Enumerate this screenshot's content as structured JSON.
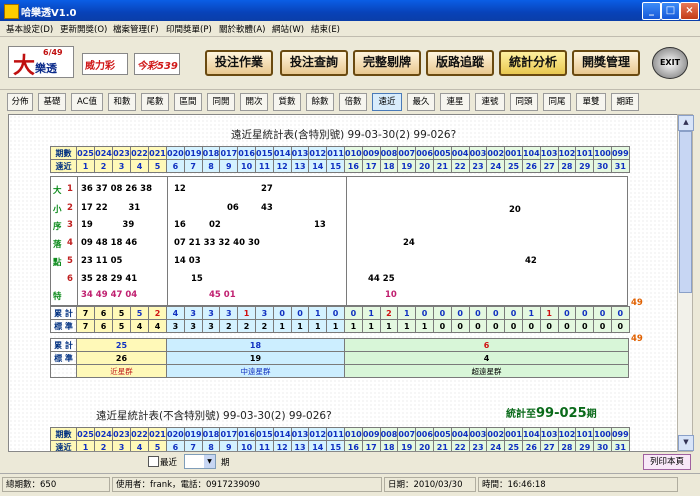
{
  "window": {
    "title": "哈樂透V1.0"
  },
  "menu": [
    "基本設定(D)",
    "更新開獎(O)",
    "檔案管理(F)",
    "印間獎單(P)",
    "關於軟體(A)",
    "網站(W)",
    "結束(E)"
  ],
  "logos": {
    "main_small": "6/49",
    "main_big": "大樂透",
    "logo2": "威力彩",
    "logo3": "今彩539"
  },
  "toolbar_buttons": [
    "投注作業",
    "投注查詢",
    "完整剔牌",
    "版路追蹤",
    "統計分析",
    "開獎管理"
  ],
  "exit_label": "EXIT",
  "tabs": [
    "分佈",
    "基礎",
    "AC值",
    "和數",
    "尾數",
    "區間",
    "同開",
    "開次",
    "質數",
    "餘數",
    "倍數",
    "遠近",
    "最久",
    "連星",
    "連號",
    "同頭",
    "同尾",
    "單雙",
    "期距"
  ],
  "active_tab": "遠近",
  "table1": {
    "title": "遠近星統計表(含特別號)  99-03-30(2)  99-026?",
    "period_label": "期數",
    "distance_label": "遠近",
    "periods_near": [
      "025",
      "024",
      "023",
      "022",
      "021"
    ],
    "periods_mid": [
      "020",
      "019",
      "018",
      "017",
      "016",
      "015",
      "014",
      "013",
      "012",
      "011"
    ],
    "periods_far": [
      "010",
      "009",
      "008",
      "007",
      "006",
      "005",
      "004",
      "003",
      "002",
      "001",
      "104",
      "103",
      "102",
      "101",
      "100",
      "099"
    ],
    "dist_near": [
      "1",
      "2",
      "3",
      "4",
      "5"
    ],
    "dist_mid": [
      "6",
      "7",
      "8",
      "9",
      "10",
      "11",
      "12",
      "13",
      "14",
      "15"
    ],
    "dist_far": [
      "16",
      "17",
      "18",
      "19",
      "20",
      "21",
      "22",
      "23",
      "24",
      "25",
      "26",
      "27",
      "28",
      "29",
      "30",
      "31"
    ],
    "side_labels": [
      "大",
      "小",
      "序",
      "落",
      "點",
      "",
      "特"
    ],
    "side_nums": [
      "1",
      "2",
      "3",
      "4",
      "5",
      "6",
      ""
    ],
    "near_rows": [
      "36 37 08 26 38",
      "17 22       31",
      "19          39",
      "09 48 18 46",
      "23 11 05",
      "35 28 29 41",
      "34 49 47 04"
    ],
    "mid_rows": [
      [
        "12",
        "27"
      ],
      [
        "06",
        "43"
      ],
      [
        "16",
        "02",
        "13"
      ],
      [
        "07 21 33 32 40 30"
      ],
      [
        "14 03"
      ],
      [
        "15"
      ],
      [
        "45 01"
      ]
    ],
    "far_rows": [
      [
        "20"
      ],
      [
        "24"
      ],
      [
        "42"
      ],
      [
        "44 25"
      ],
      [
        "10"
      ]
    ],
    "cum_label": "累 計",
    "std_label": "標 準",
    "cum_values": [
      "7",
      "6",
      "5",
      "5",
      "2",
      "4",
      "3",
      "3",
      "3",
      "1",
      "3",
      "0",
      "0",
      "1",
      "0",
      "0",
      "1",
      "2",
      "1",
      "0",
      "0",
      "0",
      "0",
      "0",
      "0",
      "1",
      "1",
      "0",
      "0",
      "0",
      "0",
      "0"
    ],
    "std_values": [
      "7",
      "6",
      "5",
      "4",
      "4",
      "3",
      "3",
      "3",
      "2",
      "2",
      "2",
      "1",
      "1",
      "1",
      "1",
      "1",
      "1",
      "1",
      "1",
      "1",
      "0",
      "0",
      "0",
      "0",
      "0",
      "0",
      "0",
      "0",
      "0",
      "0",
      "0",
      "0"
    ],
    "right_badge": "49",
    "group_cum": [
      "25",
      "18",
      "6"
    ],
    "group_std": [
      "26",
      "19",
      "4"
    ],
    "group_names": [
      "近星群",
      "中遠星群",
      "超遠星群"
    ]
  },
  "table2": {
    "title": "遠近星統計表(不含特別號)  99-03-30(2)  99-026?",
    "stat_prefix": "統計至",
    "stat_period": "99-025",
    "stat_suffix": "期",
    "period_label": "期數",
    "distance_label": "遠近"
  },
  "bottom": {
    "checkbox_label": "最近",
    "period_suffix": "期",
    "print_button": "列印本頁"
  },
  "status": {
    "total": "總期數：650",
    "user": "使用者：frank，電話：0917239090",
    "date": "日期：2010/03/30",
    "time": "時間：16:46:18"
  }
}
